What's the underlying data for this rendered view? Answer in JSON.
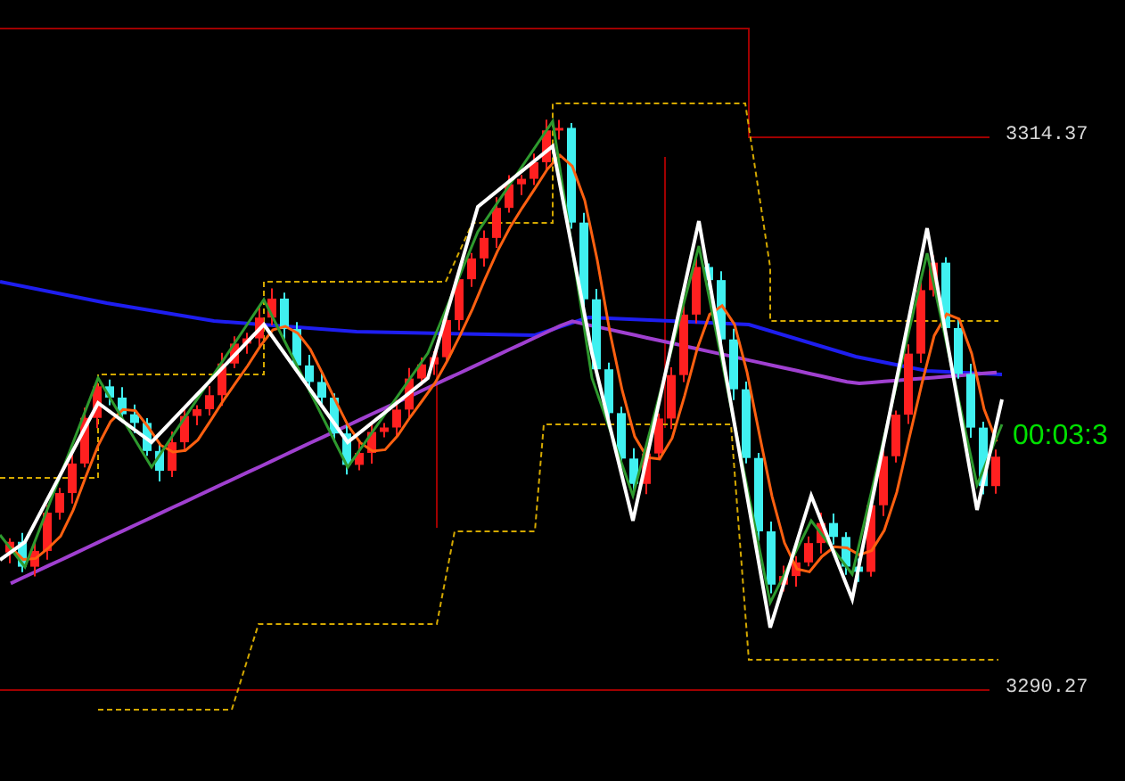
{
  "chart": {
    "price_levels": [
      {
        "kind": "upper",
        "label": "3314.37"
      },
      {
        "kind": "lower",
        "label": "3290.27"
      }
    ],
    "countdown": "00:03:3"
  }
}
